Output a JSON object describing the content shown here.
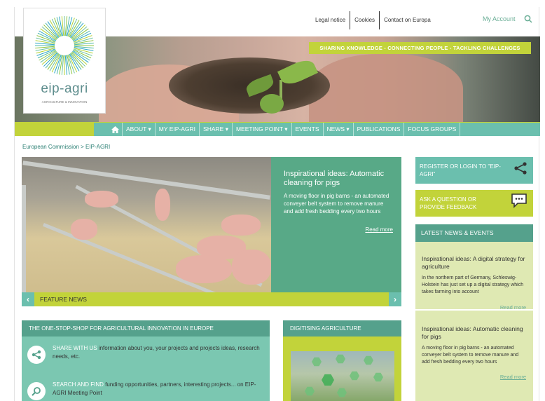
{
  "toplinks": [
    "Legal notice",
    "Cookies",
    "Contact on Europa"
  ],
  "account": "My Account",
  "logo": {
    "name": "eip-agri",
    "subtitle": "AGRICULTURE & INNOVATION"
  },
  "tagline": "SHARING KNOWLEDGE - CONNECTING PEOPLE - TACKLING CHALLENGES",
  "nav": {
    "items": [
      "ABOUT ▾",
      "MY EIP-AGRI",
      "SHARE ▾",
      "MEETING POINT ▾",
      "EVENTS",
      "NEWS ▾",
      "PUBLICATIONS",
      "FOCUS GROUPS"
    ]
  },
  "breadcrumb": "European Commission > EIP-AGRI",
  "feature": {
    "title": "Inspirational ideas: Automatic cleaning for pigs",
    "desc": "A moving floor in pig barns - an automated conveyer belt system to remove manure and add fresh bedding every two hours",
    "read_more": "Read more",
    "label": "FEATURE NEWS",
    "prev": "‹",
    "next": "›"
  },
  "oss": {
    "title": "THE ONE-STOP-SHOP FOR AGRICULTURAL INNOVATION IN EUROPE",
    "rows": [
      {
        "highlight": "SHARE WITH US",
        "text": " information about you, your projects and projects ideas, research needs, etc."
      },
      {
        "highlight": "SEARCH AND FIND",
        "text": " funding opportunities, partners, interesting projects... on EIP-AGRI Meeting Point"
      }
    ]
  },
  "digitising": {
    "title": "DIGITISING AGRICULTURE"
  },
  "sidebar": {
    "register": "REGISTER OR LOGIN TO \"EIP-AGRI\"",
    "ask": "ASK A QUESTION OR PROVIDE FEEDBACK",
    "news_title": "LATEST NEWS & EVENTS",
    "news": [
      {
        "title": "Inspirational ideas: A digital strategy for agriculture",
        "desc": "In the northern part of Germany, Schleswig-Holstein has just set up a digital strategy which takes farming into account",
        "more": "Read more"
      },
      {
        "title": "Inspirational ideas: Automatic cleaning for pigs",
        "desc": "A moving floor in pig barns - an automated conveyer belt system to remove manure and add fresh bedding every two hours",
        "more": "Read more"
      }
    ]
  },
  "colors": {
    "teal": "#6bbfae",
    "lime": "#c2d33a",
    "dark_teal": "#55a18c",
    "green": "#58a987"
  }
}
